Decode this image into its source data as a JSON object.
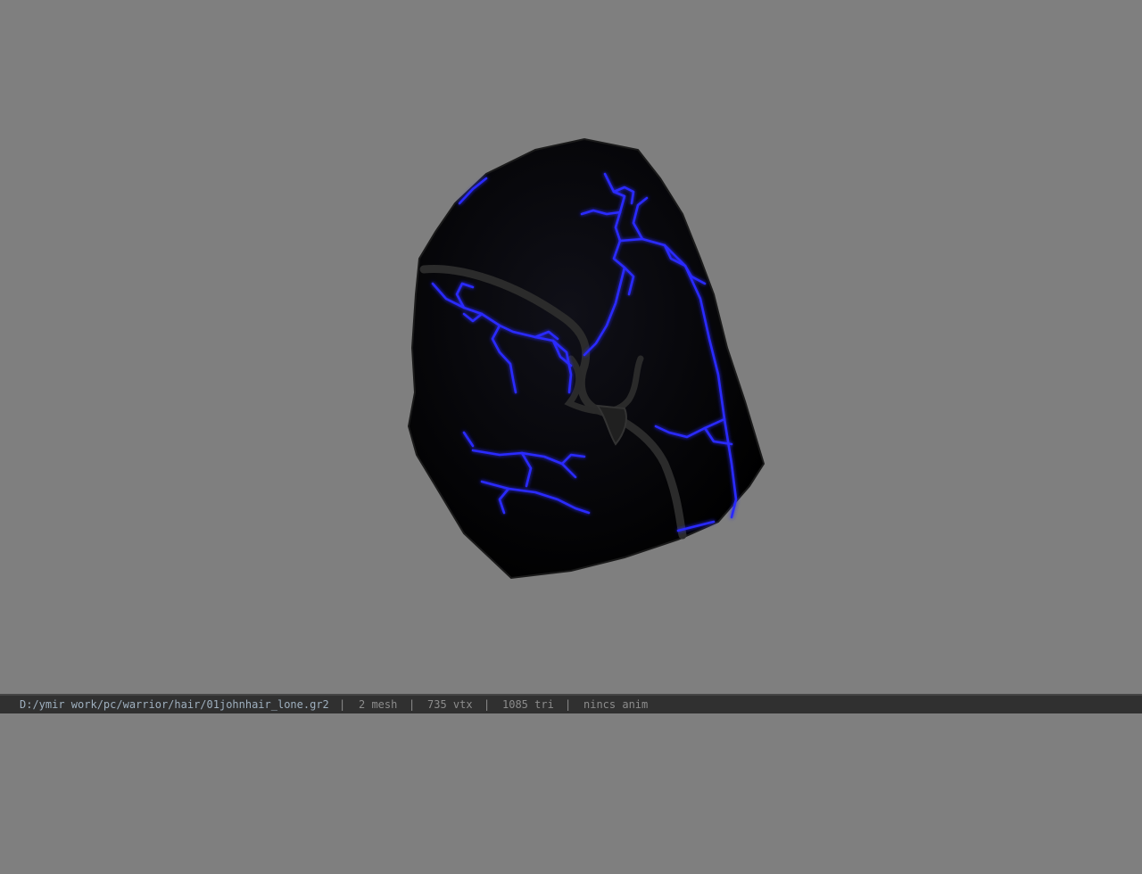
{
  "viewport": {
    "background_color": "#7f7f7f",
    "model_icon": "hooded-helmet-3d-model",
    "model_colors": {
      "body": "#050505",
      "veins": "#2a2aff",
      "rim": "#2b2b2b"
    }
  },
  "status": {
    "file_path": "D:/ymir work/pc/warrior/hair/01johnhair_lone.gr2",
    "mesh": "2 mesh",
    "vtx": "735 vtx",
    "tri": "1085 tri",
    "anim": "nincs anim",
    "separator": "|"
  }
}
